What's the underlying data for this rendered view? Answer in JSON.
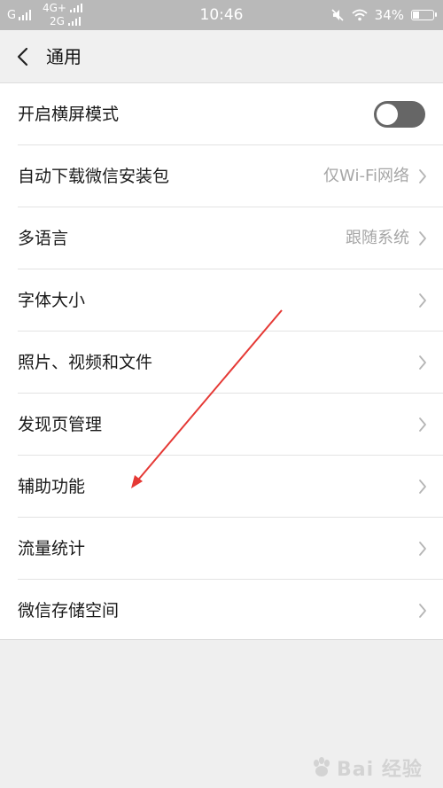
{
  "status_bar": {
    "network_g": "G",
    "network_4g": "4G+",
    "network_2g": "2G",
    "time": "10:46",
    "battery": "34%",
    "battery_level": 0.34
  },
  "header": {
    "title": "通用",
    "back_icon": "chevron-left-icon"
  },
  "settings": {
    "items": [
      {
        "label": "开启横屏模式",
        "control": "toggle",
        "enabled": false
      },
      {
        "label": "自动下载微信安装包",
        "value": "仅Wi-Fi网络"
      },
      {
        "label": "多语言",
        "value": "跟随系统"
      },
      {
        "label": "字体大小"
      },
      {
        "label": "照片、视频和文件"
      },
      {
        "label": "发现页管理"
      },
      {
        "label": "辅助功能"
      },
      {
        "label": "流量统计"
      },
      {
        "label": "微信存储空间"
      }
    ]
  },
  "annotation": {
    "color": "#e53935"
  },
  "watermark": {
    "text": "Bai 经验"
  }
}
